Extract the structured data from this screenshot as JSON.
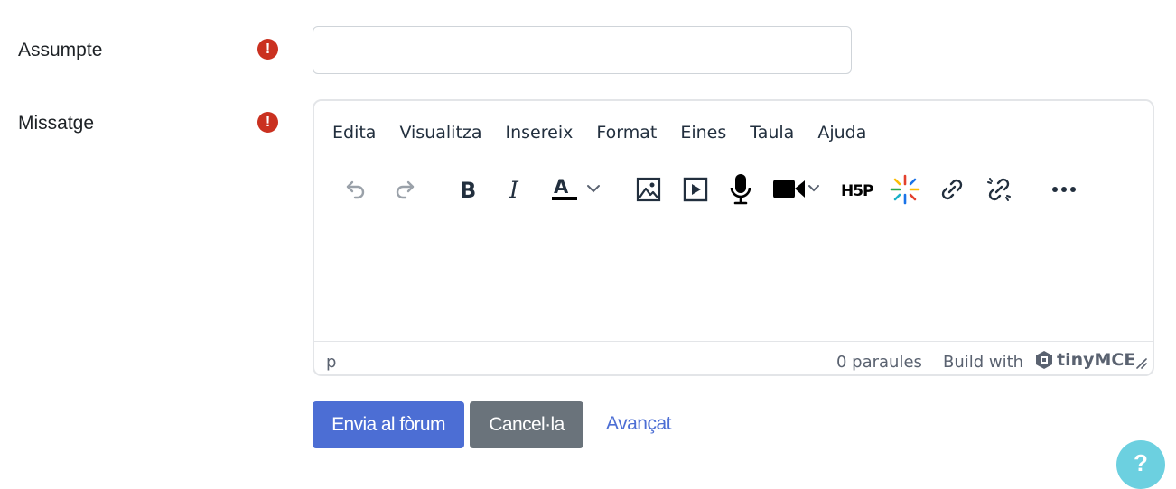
{
  "form": {
    "subject_label": "Assumpte",
    "subject_value": "",
    "message_label": "Missatge",
    "required_mark": "!"
  },
  "editor": {
    "menu": [
      "Edita",
      "Visualitza",
      "Insereix",
      "Format",
      "Eines",
      "Taula",
      "Ajuda"
    ],
    "toolbar": [
      "undo-icon",
      "redo-icon",
      "bold-icon",
      "italic-icon",
      "text-color-icon",
      "image-icon",
      "media-icon",
      "record-audio-icon",
      "record-video-icon",
      "h5p-icon",
      "ai-sparkle-icon",
      "link-icon",
      "unlink-icon",
      "more-icon"
    ],
    "content": "",
    "status": {
      "path": "p",
      "word_count": "0 paraules",
      "build_with": "Build with",
      "brand": "tinyMCE"
    }
  },
  "actions": {
    "submit": "Envia al fòrum",
    "cancel": "Cancel·la",
    "advanced": "Avançat"
  },
  "help": {
    "label": "?"
  },
  "colors": {
    "primary": "#4c6ed4",
    "secondary": "#6a737b",
    "danger": "#ca3120",
    "help": "#6cd0e0"
  }
}
